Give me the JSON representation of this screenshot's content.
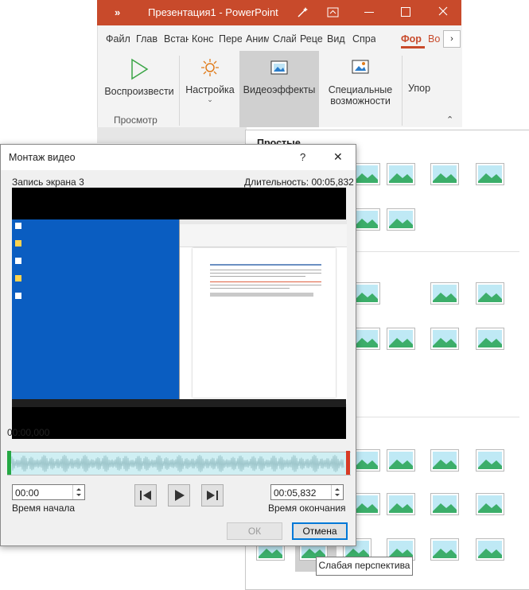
{
  "powerpoint": {
    "window_title": "Презентация1  -  PowerPoint",
    "chevron": "»",
    "tabs": [
      "Файл",
      "Глав",
      "Встан",
      "Конс",
      "Пере",
      "Аним",
      "Слай",
      "Реце",
      "Вид",
      "Спра",
      "Фор",
      "Во"
    ],
    "active_tab": "Фор",
    "ribbon": {
      "play_label": "Воспроизвести",
      "settings_label": "Настройка",
      "video_effects_label": "Видеоэффекты",
      "special_label_1": "Специальные",
      "special_label_2": "возможности",
      "arrange_label": "Упор",
      "group_preview": "Просмотр"
    }
  },
  "gallery": {
    "sections": [
      "Простые"
    ],
    "tooltip": "Слабая перспектива"
  },
  "dialog": {
    "title": "Монтаж видео",
    "help": "?",
    "close": "✕",
    "clip_name": "Запись экрана 3",
    "duration": "Длительность: 00:05,832",
    "position": "00:00,000",
    "start_time_value": "00:00",
    "start_time_label": "Время начала",
    "end_time_value": "00:05,832",
    "end_time_label": "Время окончания",
    "ok_label": "ОК",
    "cancel_label": "Отмена"
  },
  "colors": {
    "accent": "#c84a2b",
    "selection": "#d0d0d0",
    "track": "#cfeff3",
    "start_marker": "#25a844",
    "end_marker": "#d83a24"
  }
}
